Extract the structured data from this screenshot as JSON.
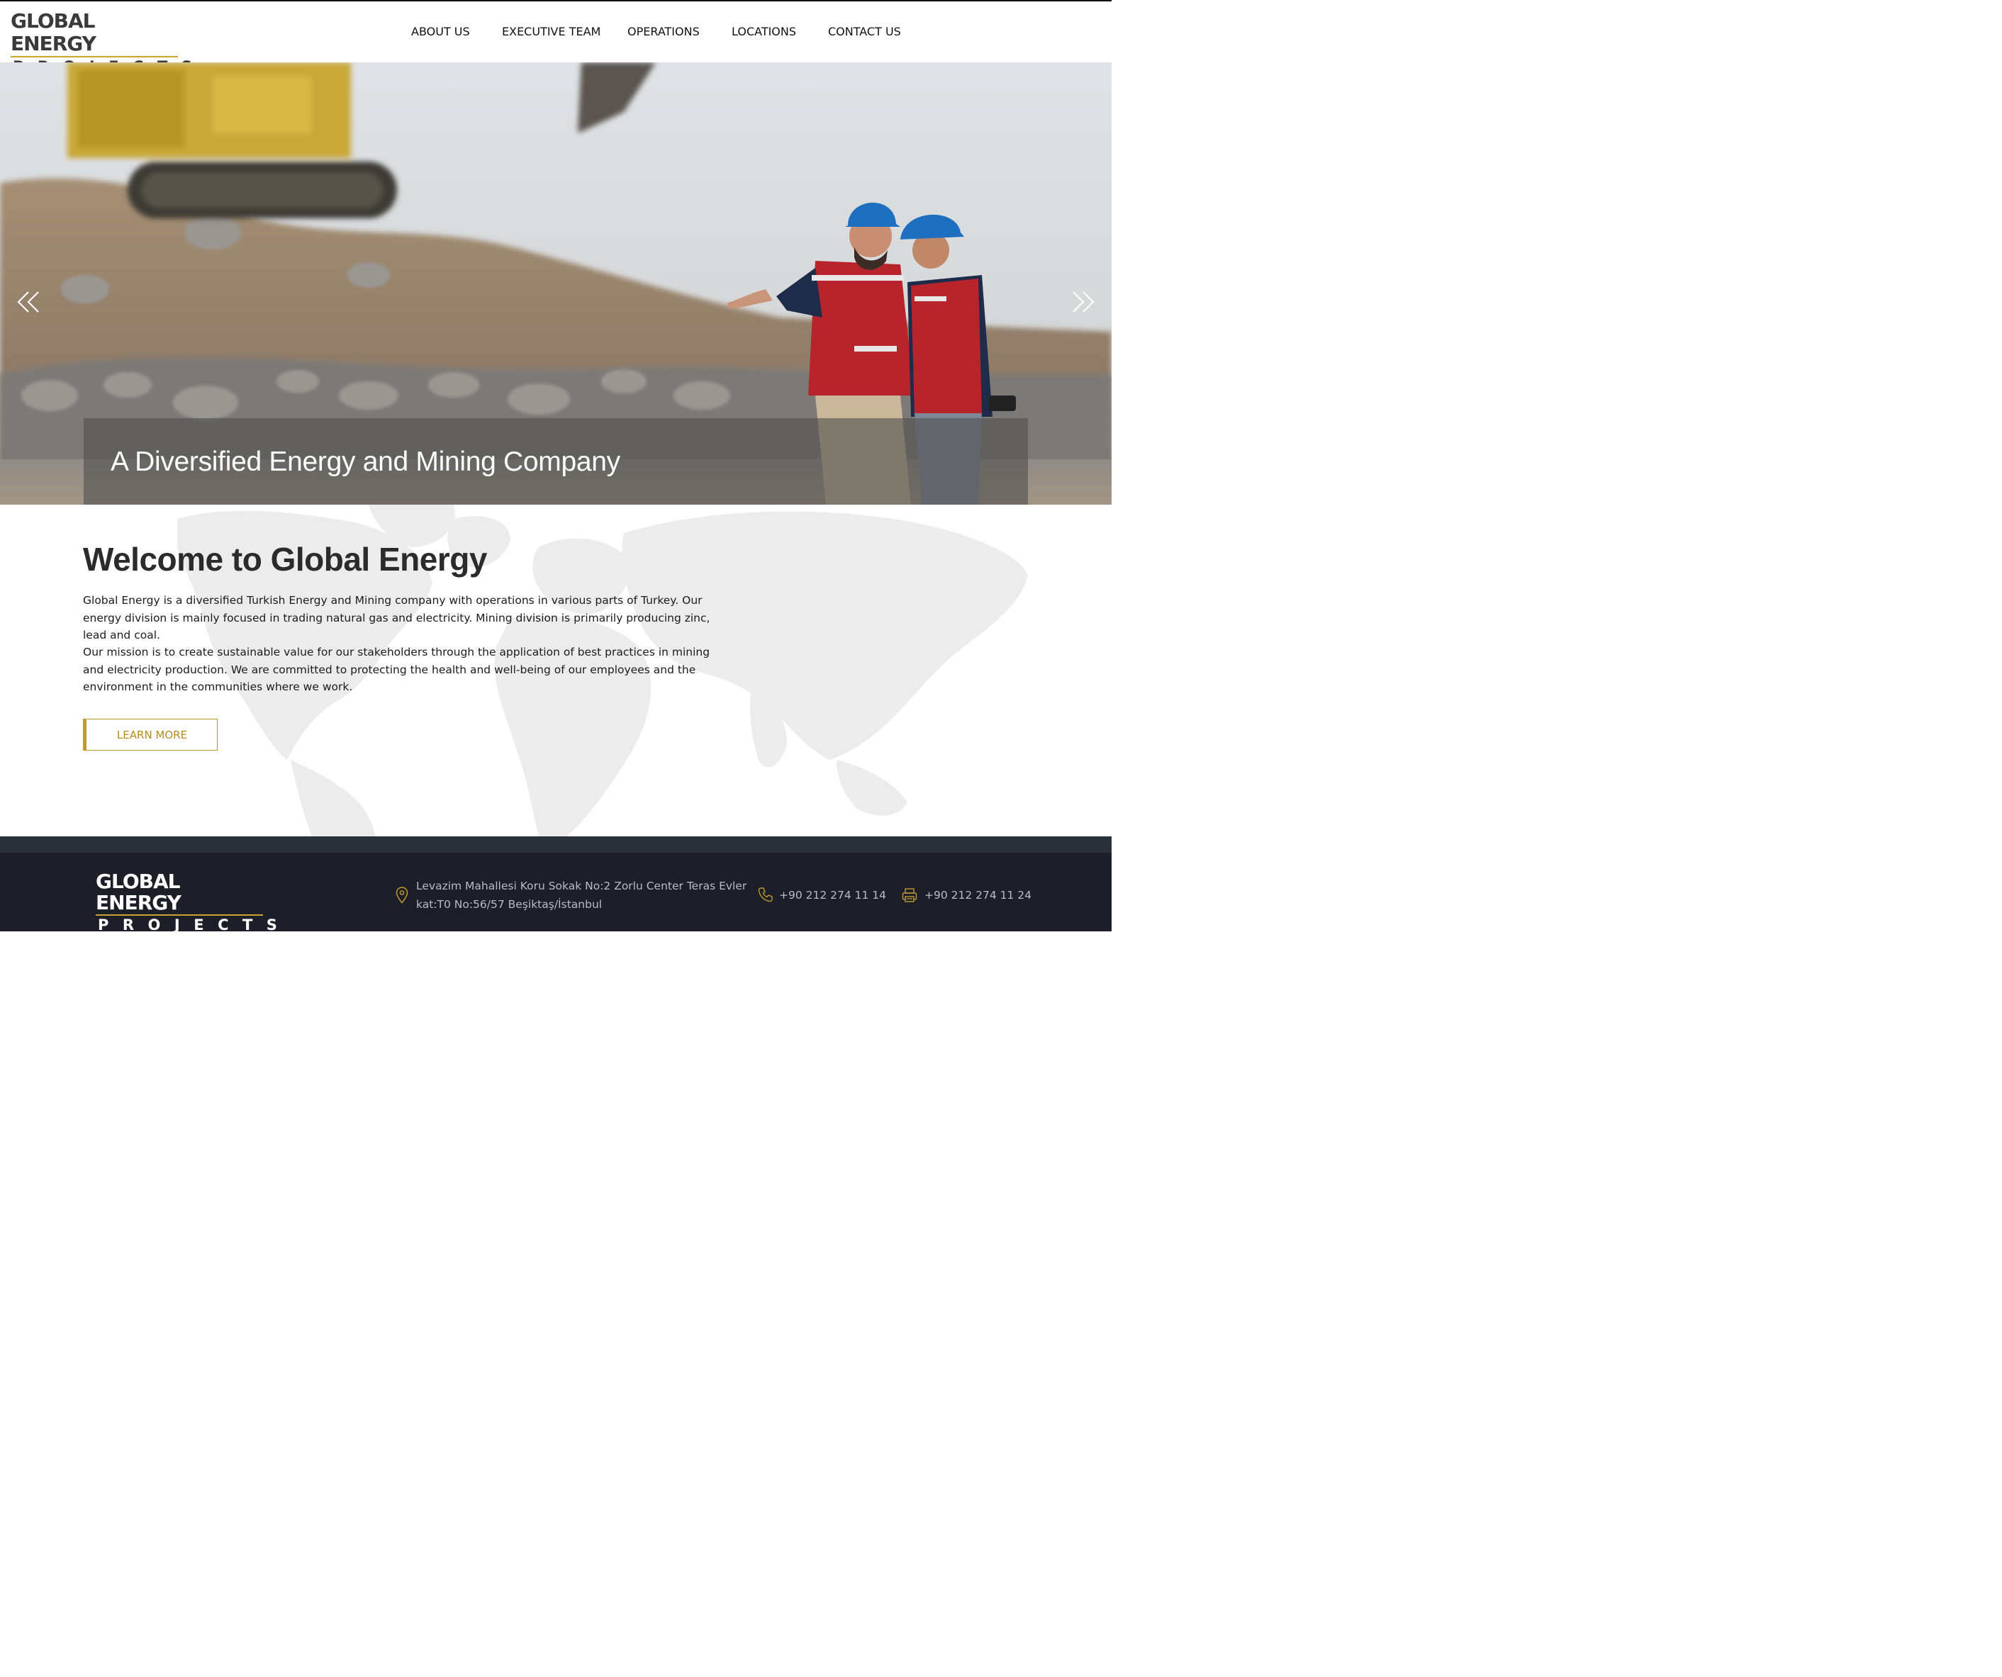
{
  "header": {
    "logo": {
      "line1": "GLOBAL ENERGY",
      "line2": "PROJECTS"
    },
    "nav": [
      {
        "label": "ABOUT US"
      },
      {
        "label": "EXECUTIVE TEAM"
      },
      {
        "label": "OPERATIONS"
      },
      {
        "label": "LOCATIONS"
      },
      {
        "label": "CONTACT US"
      }
    ]
  },
  "hero": {
    "caption": "A Diversified Energy and Mining Company",
    "prev_icon": "double-chevron-left-icon",
    "next_icon": "double-chevron-right-icon"
  },
  "welcome": {
    "title": "Welcome to Global Energy",
    "paragraph1": "Global Energy is a diversified Turkish Energy and Mining company with operations in various parts of Turkey. Our energy division is mainly focused in trading natural gas and electricity. Mining division is primarily producing zinc, lead and coal.",
    "paragraph2": "Our mission is to create sustainable value for our stakeholders through the application of best practices in mining and electricity production. We are committed to protecting the health and well-being of our employees and the environment in the communities where we work.",
    "button": "LEARN MORE"
  },
  "footer": {
    "logo": {
      "line1": "GLOBAL ENERGY",
      "line2": "PROJECTS"
    },
    "address_line1": "Levazim Mahallesi Koru Sokak No:2 Zorlu Center Teras Evler",
    "address_line2": "kat:T0 No:56/57 Beşiktaş/İstanbul",
    "phone": "+90 212 274 11 14",
    "fax": "+90 212 274 11 24"
  },
  "colors": {
    "accent_gold": "#c19a2d",
    "footer_bg": "#1c1f27",
    "footer_strip": "#2b2f38",
    "caption_overlay": "rgba(80,80,80,0.62)"
  }
}
